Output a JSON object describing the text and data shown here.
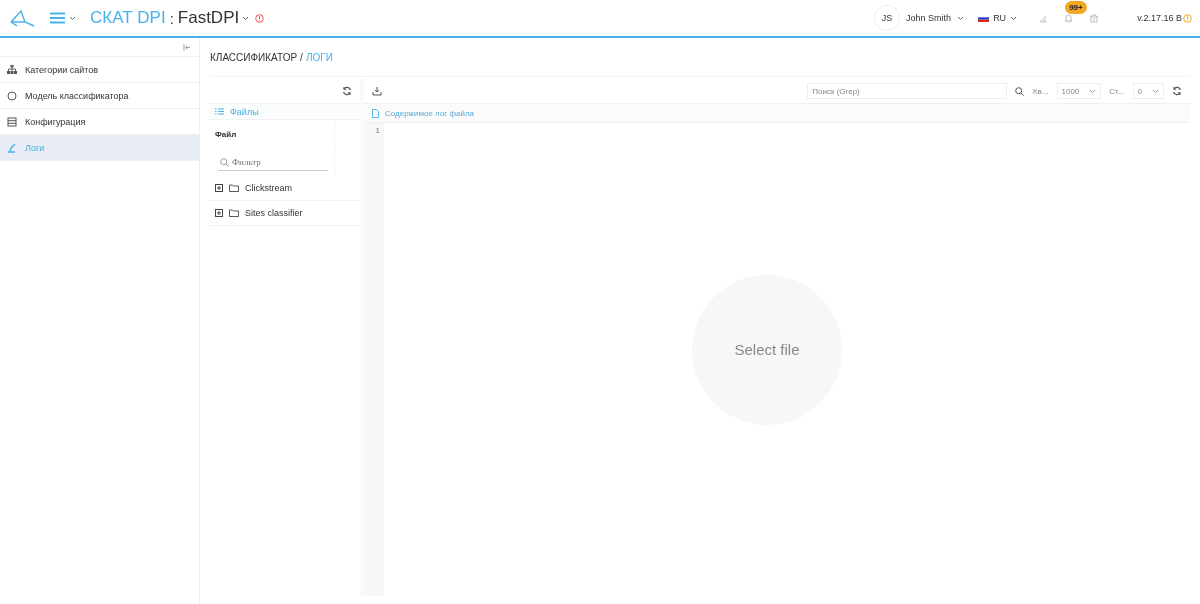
{
  "header": {
    "app_name": "СКАТ DPI",
    "separator": ":",
    "instance": "FastDPI",
    "user": {
      "initials": "JS",
      "name": "John Smith"
    },
    "language": "RU",
    "notifications_badge": "99+",
    "version": "v.2.17.16 B"
  },
  "sidebar": {
    "items": [
      {
        "label": "Категории сайтов",
        "kind": "hierarchy",
        "selected": false
      },
      {
        "label": "Модель классификатора",
        "kind": "circle",
        "selected": false
      },
      {
        "label": "Конфигурация",
        "kind": "table",
        "selected": false
      },
      {
        "label": "Логи",
        "kind": "brush",
        "selected": true
      }
    ]
  },
  "breadcrumb": {
    "separator": "/",
    "items": [
      {
        "label": "КЛАССИФИКАТОР",
        "selected": false
      },
      {
        "label": "ЛОГИ",
        "selected": true
      }
    ]
  },
  "files_panel": {
    "tab": "Файлы",
    "column": "Файл",
    "filter_placeholder": "Фильтр",
    "tree": [
      {
        "label": "Clickstream",
        "expanded": false
      },
      {
        "label": "Sites classifier",
        "expanded": false
      }
    ]
  },
  "log_panel": {
    "disabled": true,
    "search_placeholder": "Поиск (Grep)",
    "tail_label": "Хв...",
    "tail_value": "1000",
    "page_label": "Ст...",
    "page_value": "0",
    "content_title": "Содержимое лог файла",
    "line_numbers": [
      "1"
    ],
    "empty_message": "Select file"
  }
}
